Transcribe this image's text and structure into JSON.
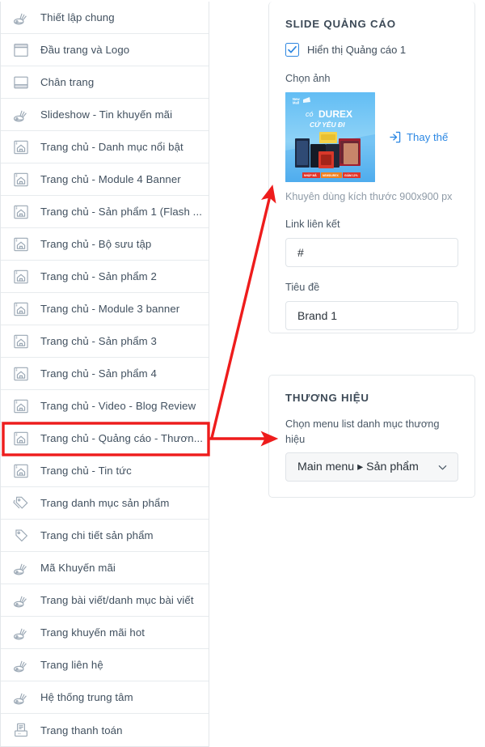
{
  "sidebar": {
    "items": [
      {
        "label": "Thiết lập chung",
        "icon": "tools-icon"
      },
      {
        "label": "Đầu trang và Logo",
        "icon": "header-layout-icon"
      },
      {
        "label": "Chân trang",
        "icon": "footer-layout-icon"
      },
      {
        "label": "Slideshow - Tin khuyến mãi",
        "icon": "tools-icon"
      },
      {
        "label": "Trang chủ - Danh mục nổi bật",
        "icon": "home-frame-icon"
      },
      {
        "label": "Trang chủ - Module 4 Banner",
        "icon": "home-frame-icon"
      },
      {
        "label": "Trang chủ - Sản phẩm 1 (Flash ...",
        "icon": "home-frame-icon"
      },
      {
        "label": "Trang chủ - Bộ sưu tập",
        "icon": "home-frame-icon"
      },
      {
        "label": "Trang chủ - Sản phẩm 2",
        "icon": "home-frame-icon"
      },
      {
        "label": "Trang chủ - Module 3 banner",
        "icon": "home-frame-icon"
      },
      {
        "label": "Trang chủ - Sản phẩm 3",
        "icon": "home-frame-icon"
      },
      {
        "label": "Trang chủ - Sản phẩm 4",
        "icon": "home-frame-icon"
      },
      {
        "label": "Trang chủ - Video - Blog Review",
        "icon": "home-frame-icon"
      },
      {
        "label": "Trang chủ - Quảng cáo - Thươn...",
        "icon": "home-frame-icon"
      },
      {
        "label": "Trang chủ - Tin tức",
        "icon": "home-frame-icon"
      },
      {
        "label": "Trang danh mục sản phẩm",
        "icon": "tags-icon"
      },
      {
        "label": "Trang chi tiết sản phẩm",
        "icon": "tag-icon"
      },
      {
        "label": "Mã Khuyến mãi",
        "icon": "tools-icon"
      },
      {
        "label": "Trang bài viết/danh mục bài viết",
        "icon": "tools-icon"
      },
      {
        "label": "Trang khuyến mãi hot",
        "icon": "tools-icon"
      },
      {
        "label": "Trang liên hệ",
        "icon": "tools-icon"
      },
      {
        "label": "Hệ thống trung tâm",
        "icon": "tools-icon"
      },
      {
        "label": "Trang thanh toán",
        "icon": "register-icon"
      }
    ],
    "highlighted_index": 13
  },
  "slide_panel": {
    "title": "SLIDE QUẢNG CÁO",
    "checkbox_label": "Hiển thị Quảng cáo 1",
    "checkbox_checked": true,
    "image_label": "Chọn ảnh",
    "image_alt": "có DUREX cứ yêu đi",
    "image_brand": "DUREX",
    "image_line1": "có",
    "image_line2": "cứ yêu đi",
    "image_logo": "New Mall",
    "image_tag1": "NHẬP MÃ",
    "image_tag2": "NEWDUREX",
    "image_tag3": "GIẢM 12%",
    "replace_label": "Thay thế",
    "replace_icon": "import-icon",
    "size_hint": "Khuyên dùng kích thước 900x900 px",
    "link_label": "Link liên kết",
    "link_value": "#",
    "title_label": "Tiêu đề",
    "title_value": "Brand 1"
  },
  "brand_panel": {
    "title": "THƯƠNG HIỆU",
    "select_label": "Chọn menu list danh mục thương hiệu",
    "select_value": "Main menu ▸ Sản phẩm",
    "chevron_icon": "chevron-down-icon"
  },
  "annotation": {
    "color": "#ee1c1c",
    "highlight_box": "red-rectangle-around-selected-item",
    "arrow_1": "arrow-to-slide-panel",
    "arrow_2": "arrow-to-brand-panel"
  },
  "colors": {
    "accent": "#2b87e3",
    "text": "#41505f",
    "muted": "#8e9aa6",
    "border": "#e4e8eb",
    "annotation_red": "#ee1c1c",
    "thumb_blue": "#4eaef0"
  }
}
